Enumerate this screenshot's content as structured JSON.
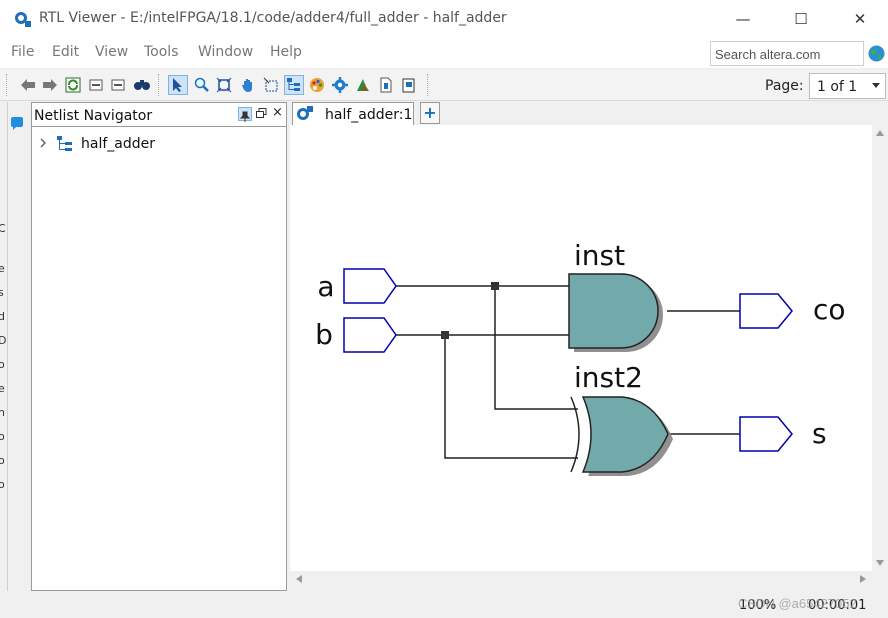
{
  "window": {
    "title": "RTL Viewer - E:/intelFPGA/18.1/code/adder4/full_adder - half_adder",
    "minimize_glyph": "—",
    "maximize_glyph": "☐",
    "close_glyph": "✕"
  },
  "menu": [
    "File",
    "Edit",
    "View",
    "Tools",
    "Window",
    "Help"
  ],
  "search": {
    "value": "Search altera.com"
  },
  "toolbar": {
    "icons": [
      "back-icon",
      "forward-icon",
      "refresh-icon",
      "go-up-icon",
      "go-down-icon",
      "find-icon",
      "select-pointer-icon",
      "zoom-icon",
      "fit-window-icon",
      "hand-pan-icon",
      "selection-box-icon",
      "hierarchy-icon",
      "color-palette-icon",
      "settings-gear-icon",
      "filter-icon",
      "export-icon",
      "page-setup-icon"
    ],
    "page_label": "Page:",
    "page_value": "1 of 1"
  },
  "netlist": {
    "title": "Netlist Navigator",
    "tree": [
      {
        "label": "half_adder",
        "expanded": false
      }
    ]
  },
  "tabs": [
    {
      "label": "half_adder:1"
    }
  ],
  "add_tab_glyph": "+",
  "schematic": {
    "inputs": [
      "a",
      "b"
    ],
    "outputs": [
      "co",
      "s"
    ],
    "instances": [
      {
        "name": "inst",
        "type": "AND"
      },
      {
        "name": "inst2",
        "type": "XOR"
      }
    ],
    "colors": {
      "gate_fill": "#72aaab",
      "port_stroke": "#0000b0",
      "wire": "#222222",
      "shadow": "#909090"
    }
  },
  "left_strip_chars": [
    "C",
    "e",
    "s",
    "d",
    "D",
    "o",
    "e",
    "n",
    "o",
    "o",
    "o"
  ],
  "status": {
    "zoom": "100%",
    "time": "00:00:01",
    "watermark": "CSDN @a65427052"
  }
}
